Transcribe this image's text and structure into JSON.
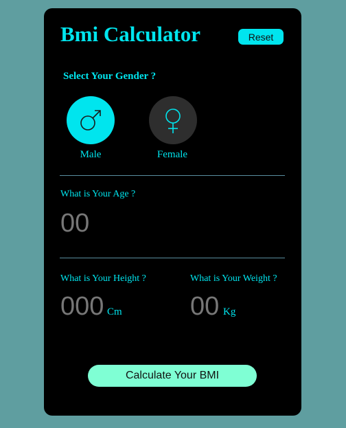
{
  "app": {
    "title": "Bmi Calculator",
    "reset_label": "Reset"
  },
  "gender": {
    "question": "Select Your Gender ?",
    "options": [
      {
        "label": "Male",
        "icon": "male-symbol-icon",
        "selected": true
      },
      {
        "label": "Female",
        "icon": "female-symbol-icon",
        "selected": false
      }
    ]
  },
  "age": {
    "question": "What is Your Age ?",
    "placeholder": "00"
  },
  "height": {
    "question": "What is Your Height ?",
    "placeholder": "000",
    "unit": "Cm"
  },
  "weight": {
    "question": "What is Your Weight ?",
    "placeholder": "00",
    "unit": "Kg"
  },
  "calculate_label": "Calculate Your BMI",
  "colors": {
    "background": "#5f9ea0",
    "card": "#000000",
    "accent": "#00e5ee",
    "female_button": "#2e2e2e",
    "calculate_button": "#7fffd4",
    "placeholder_text": "#777777"
  }
}
